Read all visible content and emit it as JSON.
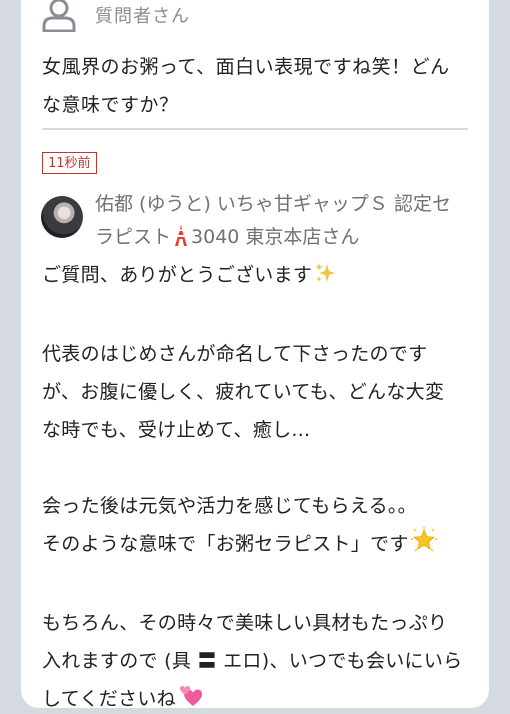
{
  "question": {
    "user_label": "質問者さん",
    "line1": "女風界のお粥って、面白い表現ですね笑！どん",
    "line2": "な意味ですか？"
  },
  "answer": {
    "time_badge": "11秒前",
    "name_line1": "佑都 (ゆうと) いちゃ甘ギャップＳ 認定セ",
    "name_line2_a": "ラピスト",
    "name_line2_b": "3040 東京本店さん",
    "p1": "ご質問、ありがとうございます",
    "p2_l1": "代表のはじめさんが命名して下さったのです",
    "p2_l2": "が、お腹に優しく、疲れていても、どんな大変",
    "p2_l3": "な時でも、受け止めて、癒し...",
    "p3_l1": "会った後は元気や活力を感じてもらえる。。",
    "p3_l2": "そのような意味で「お粥セラピスト」です",
    "p4_l1": "もちろん、その時々で美味しい具材もたっぷり",
    "p4_l2": "入れますので (具 〓 エロ)、いつでも会いにいら",
    "p4_l3": "してくださいね"
  },
  "icons": {
    "question_avatar": "person-outline-icon",
    "tower": "tokyo-tower-icon",
    "sparkles": "sparkles-icon",
    "glowing_star": "glowing-star-icon",
    "two_hearts": "two-hearts-icon"
  },
  "colors": {
    "background": "#d5d9e0",
    "card": "#ffffff",
    "badge": "#c0392b",
    "muted_text": "#8a8d93"
  }
}
